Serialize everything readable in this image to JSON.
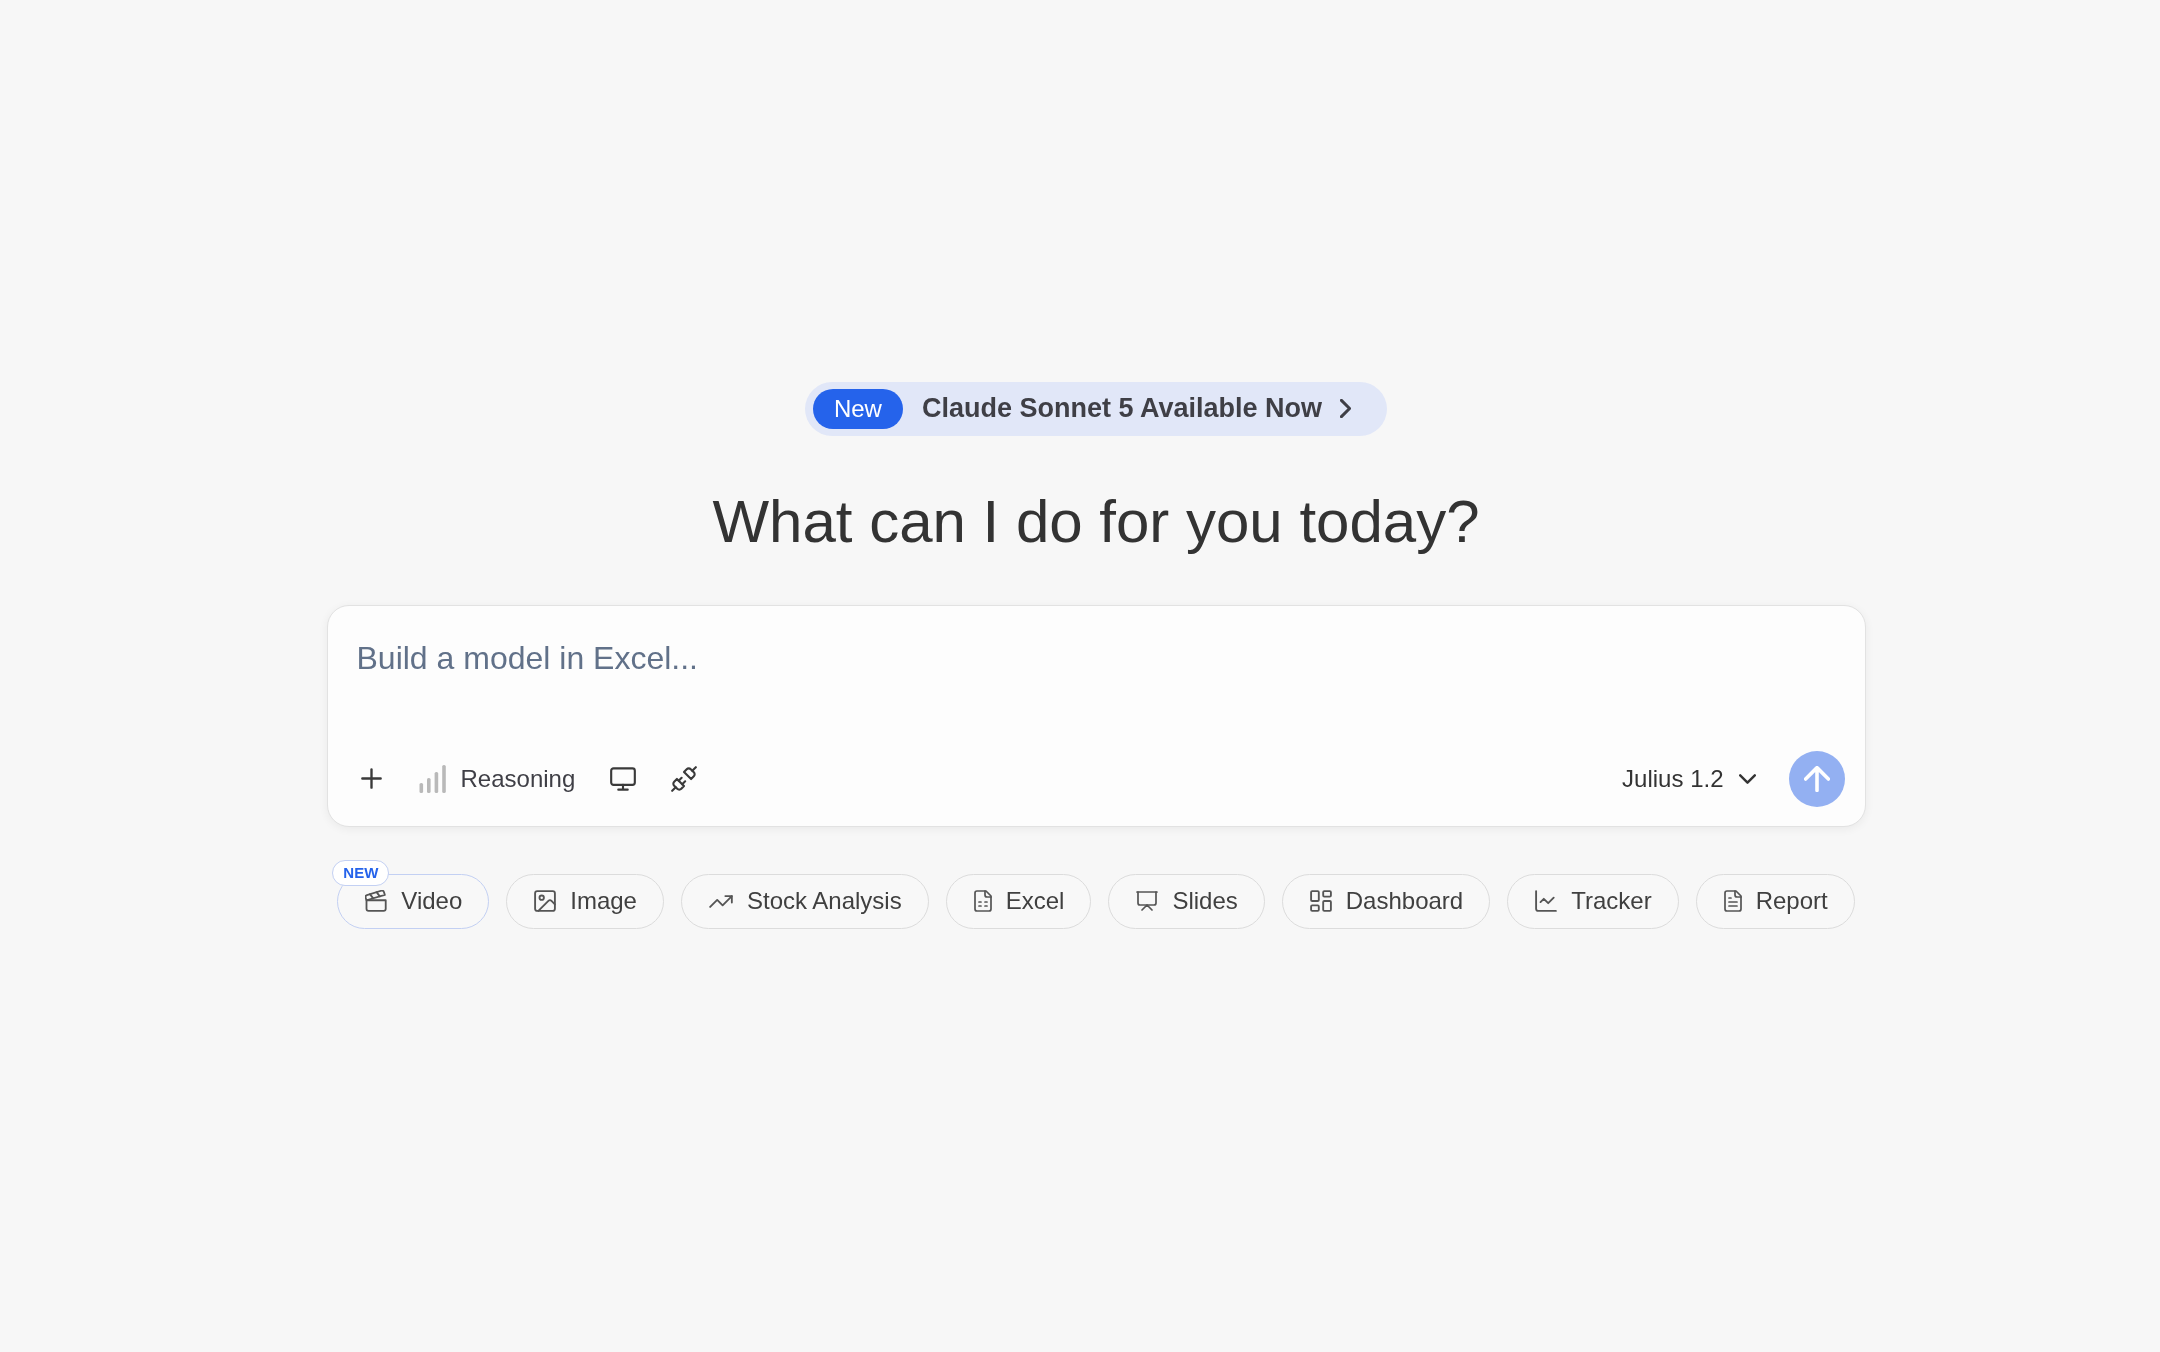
{
  "banner": {
    "badge": "New",
    "text": "Claude Sonnet 5 Available Now"
  },
  "heading": "What can I do for you today?",
  "composer": {
    "placeholder": "Build a model in Excel...",
    "reasoning_label": "Reasoning",
    "model_label": "Julius 1.2",
    "send_button": {
      "disabled": true
    }
  },
  "suggestions": [
    {
      "label": "Video",
      "kind": "video",
      "badge": "NEW"
    },
    {
      "label": "Image",
      "kind": "image"
    },
    {
      "label": "Stock Analysis",
      "kind": "stocks"
    },
    {
      "label": "Excel",
      "kind": "excel"
    },
    {
      "label": "Slides",
      "kind": "slides"
    },
    {
      "label": "Dashboard",
      "kind": "dashboard"
    },
    {
      "label": "Tracker",
      "kind": "tracker"
    },
    {
      "label": "Report",
      "kind": "report"
    }
  ]
}
